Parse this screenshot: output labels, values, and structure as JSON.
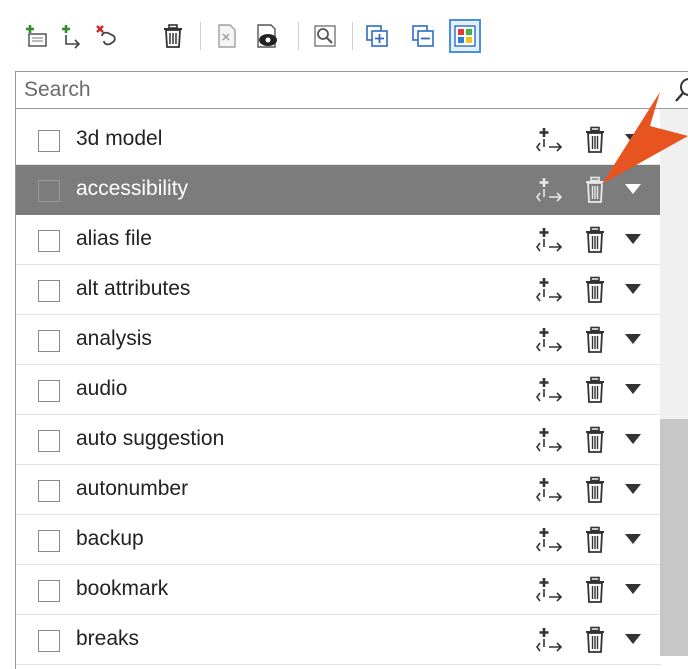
{
  "toolbar": {
    "buttons": [
      {
        "name": "add-term-button",
        "icon": "add-term-icon"
      },
      {
        "name": "add-subterm-button",
        "icon": "add-subterm-icon"
      },
      {
        "name": "remove-link-button",
        "icon": "remove-link-icon"
      },
      {
        "name": "delete-button",
        "icon": "trash-icon"
      },
      {
        "name": "open-file-button",
        "icon": "document-icon"
      },
      {
        "name": "preview-button",
        "icon": "preview-icon"
      },
      {
        "name": "properties-button",
        "icon": "properties-icon"
      },
      {
        "name": "expand-all-button",
        "icon": "expand-all-icon"
      },
      {
        "name": "collapse-all-button",
        "icon": "collapse-all-icon"
      },
      {
        "name": "color-view-button",
        "icon": "color-grid-icon",
        "active": true
      }
    ]
  },
  "search": {
    "placeholder": "Search",
    "value": ""
  },
  "items": [
    {
      "label": "3d model",
      "selected": false
    },
    {
      "label": "accessibility",
      "selected": true
    },
    {
      "label": "alias file",
      "selected": false
    },
    {
      "label": "alt attributes",
      "selected": false
    },
    {
      "label": "analysis",
      "selected": false
    },
    {
      "label": "audio",
      "selected": false
    },
    {
      "label": "auto suggestion",
      "selected": false
    },
    {
      "label": "autonumber",
      "selected": false
    },
    {
      "label": "backup",
      "selected": false
    },
    {
      "label": "bookmark",
      "selected": false
    },
    {
      "label": "breaks",
      "selected": false
    }
  ],
  "colors": {
    "selected_row": "#7c7c7c",
    "pointer": "#e8541f",
    "active_button_border": "#4a8fe0"
  }
}
